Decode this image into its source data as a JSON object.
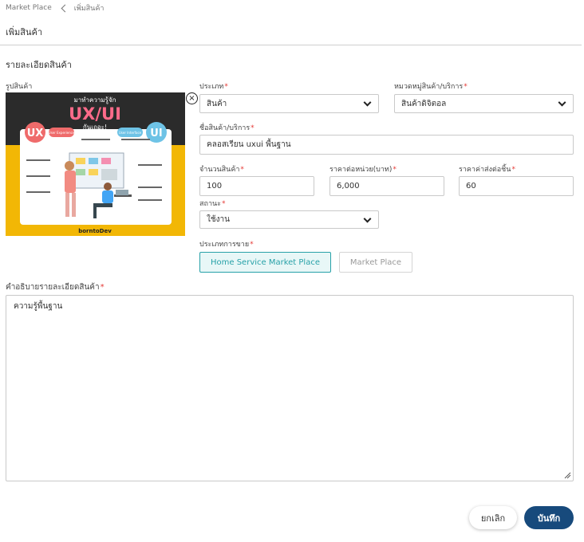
{
  "breadcrumb": {
    "root": "Market Place",
    "current": "เพิ่มสินค้า"
  },
  "page_title": "เพิ่มสินค้า",
  "section_title": "รายละเอียดสินค้า",
  "image": {
    "label": "รูปสินค้า",
    "caption_top": "มาทำความรู้จัก",
    "caption_main": "UX/UI",
    "caption_sub": "กันเถอะ!",
    "left_badge": "UX",
    "left_badge_sub": "User Experience",
    "right_badge": "UI",
    "right_badge_sub": "User Interface",
    "brand": "borntoDev"
  },
  "form": {
    "type": {
      "label": "ประเภท",
      "value": "สินค้า"
    },
    "category": {
      "label": "หมวดหมู่สินค้า/บริการ",
      "value": "สินค้าดิจิตอล"
    },
    "name": {
      "label": "ชื่อสินค้า/บริการ",
      "value": "คลอสเรียน uxui พื้นฐาน"
    },
    "quantity": {
      "label": "จำนวนสินค้า",
      "value": "100"
    },
    "unit_price": {
      "label": "ราคาต่อหน่วย(บาท)",
      "value": "6,000"
    },
    "shipping": {
      "label": "ราคาค่าส่งต่อชิ้น",
      "value": "60"
    },
    "status": {
      "label": "สถานะ",
      "value": "ใช้งาน"
    },
    "sale_type": {
      "label": "ประเภทการขาย",
      "options": [
        "Home Service Market Place",
        "Market Place"
      ],
      "selected": "Home Service Market Place"
    },
    "description": {
      "label": "คำอธิบายรายละเอียดสินค้า",
      "value": "ความรู้พื้นฐาน"
    }
  },
  "required_mark": "*",
  "actions": {
    "cancel": "ยกเลิก",
    "save": "บันทึก"
  },
  "colors": {
    "accent": "#27a1a8",
    "primary": "#174a7c",
    "required": "#e53935"
  }
}
